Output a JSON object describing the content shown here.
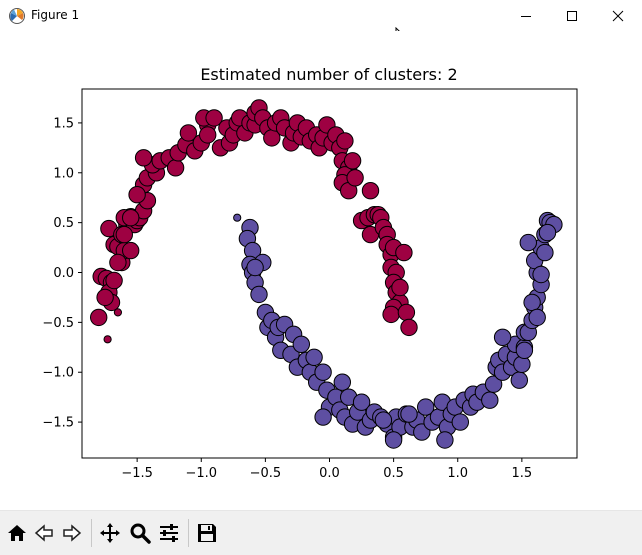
{
  "window": {
    "title": "Figure 1",
    "controls": [
      "minimize",
      "maximize",
      "close"
    ]
  },
  "toolbar": {
    "tools": [
      "home-icon",
      "back-icon",
      "forward-icon",
      "pan-icon",
      "zoom-icon",
      "configure-subplots-icon",
      "save-icon"
    ]
  },
  "colors": {
    "cluster_0": "#9e0142",
    "cluster_1": "#5e4fa2",
    "edge": "#000000"
  },
  "chart_data": {
    "type": "scatter",
    "title": "Estimated number of clusters: 2",
    "xlabel": "",
    "ylabel": "",
    "xlim": [
      -1.93,
      1.93
    ],
    "ylim": [
      -1.86,
      1.84
    ],
    "xticks": [
      -1.5,
      -1.0,
      -0.5,
      0.0,
      0.5,
      1.0,
      1.5
    ],
    "xtick_labels": [
      "−1.5",
      "−1.0",
      "−0.5",
      "0.0",
      "0.5",
      "1.0",
      "1.5"
    ],
    "yticks": [
      -1.5,
      -1.0,
      -0.5,
      0.0,
      0.5,
      1.0,
      1.5
    ],
    "ytick_labels": [
      "−1.5",
      "−1.0",
      "−0.5",
      "0.0",
      "0.5",
      "1.0",
      "1.5"
    ],
    "grid": false,
    "series": [
      {
        "cluster": 0,
        "color": "#9e0142",
        "core_points": [
          [
            -1.78,
            -0.04
          ],
          [
            -1.8,
            -0.45
          ],
          [
            -1.74,
            -0.06
          ],
          [
            -1.7,
            -0.1
          ],
          [
            -1.72,
            -0.2
          ],
          [
            -1.7,
            -0.3
          ],
          [
            -1.68,
            -0.08
          ],
          [
            -1.72,
            0.44
          ],
          [
            -1.68,
            0.28
          ],
          [
            -1.65,
            0.26
          ],
          [
            -1.62,
            0.1
          ],
          [
            -1.6,
            0.22
          ],
          [
            -1.58,
            0.48
          ],
          [
            -1.55,
            0.56
          ],
          [
            -1.6,
            0.55
          ],
          [
            -1.52,
            0.48
          ],
          [
            -1.5,
            0.52
          ],
          [
            -1.48,
            0.55
          ],
          [
            -1.45,
            0.62
          ],
          [
            -1.42,
            0.72
          ],
          [
            -1.45,
            0.88
          ],
          [
            -1.5,
            0.78
          ],
          [
            -1.42,
            0.95
          ],
          [
            -1.35,
            1.0
          ],
          [
            -1.38,
            1.08
          ],
          [
            -1.45,
            1.15
          ],
          [
            -1.32,
            1.12
          ],
          [
            -1.25,
            1.15
          ],
          [
            -1.2,
            1.05
          ],
          [
            -1.18,
            1.2
          ],
          [
            -1.12,
            1.28
          ],
          [
            -1.1,
            1.4
          ],
          [
            -1.05,
            1.22
          ],
          [
            -1.0,
            1.3
          ],
          [
            -0.95,
            1.48
          ],
          [
            -0.98,
            1.55
          ],
          [
            -0.95,
            1.38
          ],
          [
            -0.9,
            1.55
          ],
          [
            -0.85,
            1.25
          ],
          [
            -0.8,
            1.45
          ],
          [
            -0.78,
            1.3
          ],
          [
            -0.75,
            1.38
          ],
          [
            -0.72,
            1.5
          ],
          [
            -0.7,
            1.55
          ],
          [
            -0.66,
            1.4
          ],
          [
            -0.62,
            1.5
          ],
          [
            -0.58,
            1.48
          ],
          [
            -0.58,
            1.6
          ],
          [
            -0.55,
            1.65
          ],
          [
            -0.52,
            1.55
          ],
          [
            -0.48,
            1.45
          ],
          [
            -0.45,
            1.35
          ],
          [
            -0.42,
            1.5
          ],
          [
            -0.38,
            1.55
          ],
          [
            -0.35,
            1.45
          ],
          [
            -0.3,
            1.3
          ],
          [
            -0.28,
            1.4
          ],
          [
            -0.25,
            1.5
          ],
          [
            -0.22,
            1.36
          ],
          [
            -0.18,
            1.45
          ],
          [
            -0.15,
            1.32
          ],
          [
            -0.1,
            1.38
          ],
          [
            -0.08,
            1.25
          ],
          [
            -0.05,
            1.35
          ],
          [
            -0.02,
            1.48
          ],
          [
            0.02,
            1.3
          ],
          [
            0.05,
            1.38
          ],
          [
            0.08,
            1.25
          ],
          [
            0.1,
            1.12
          ],
          [
            0.12,
            1.32
          ],
          [
            0.15,
            1.05
          ],
          [
            0.12,
            0.98
          ],
          [
            0.1,
            0.9
          ],
          [
            0.15,
            0.82
          ],
          [
            0.18,
            1.12
          ],
          [
            0.2,
            0.95
          ],
          [
            0.25,
            0.52
          ],
          [
            0.3,
            0.55
          ],
          [
            0.32,
            0.38
          ],
          [
            0.32,
            0.82
          ],
          [
            0.35,
            0.58
          ],
          [
            0.38,
            0.58
          ],
          [
            0.4,
            0.55
          ],
          [
            0.42,
            0.45
          ],
          [
            0.45,
            0.38
          ],
          [
            0.45,
            0.28
          ],
          [
            0.48,
            0.18
          ],
          [
            0.5,
            0.25
          ],
          [
            0.48,
            0.05
          ],
          [
            0.52,
            0.0
          ],
          [
            0.5,
            -0.1
          ],
          [
            0.52,
            -0.2
          ],
          [
            0.55,
            -0.3
          ],
          [
            0.5,
            -0.35
          ],
          [
            0.48,
            -0.42
          ],
          [
            0.55,
            -0.15
          ],
          [
            0.58,
            0.2
          ],
          [
            0.6,
            -0.4
          ],
          [
            0.62,
            -0.55
          ],
          [
            -1.62,
            0.38
          ],
          [
            -1.55,
            0.55
          ],
          [
            -1.65,
            0.1
          ],
          [
            -1.75,
            -0.25
          ],
          [
            -1.6,
            0.38
          ],
          [
            -1.55,
            0.22
          ]
        ],
        "outliers": [
          [
            -1.73,
            -0.67
          ],
          [
            -1.65,
            -0.4
          ]
        ]
      },
      {
        "cluster": 1,
        "color": "#5e4fa2",
        "core_points": [
          [
            -0.62,
            0.45
          ],
          [
            -0.64,
            0.34
          ],
          [
            -0.6,
            0.22
          ],
          [
            -0.62,
            0.08
          ],
          [
            -0.6,
            0.0
          ],
          [
            -0.58,
            -0.1
          ],
          [
            -0.55,
            -0.22
          ],
          [
            -0.52,
            0.1
          ],
          [
            -0.5,
            -0.4
          ],
          [
            -0.48,
            -0.55
          ],
          [
            -0.45,
            -0.48
          ],
          [
            -0.42,
            -0.65
          ],
          [
            -0.4,
            -0.55
          ],
          [
            -0.35,
            -0.52
          ],
          [
            -0.38,
            -0.78
          ],
          [
            -0.3,
            -0.82
          ],
          [
            -0.28,
            -0.62
          ],
          [
            -0.25,
            -0.95
          ],
          [
            -0.22,
            -0.72
          ],
          [
            -0.18,
            -0.88
          ],
          [
            -0.15,
            -1.0
          ],
          [
            -0.12,
            -0.85
          ],
          [
            -0.1,
            -1.1
          ],
          [
            -0.05,
            -1.0
          ],
          [
            -0.02,
            -1.18
          ],
          [
            0.0,
            -1.35
          ],
          [
            -0.05,
            -1.45
          ],
          [
            0.05,
            -1.25
          ],
          [
            0.08,
            -1.38
          ],
          [
            0.1,
            -1.1
          ],
          [
            0.12,
            -1.45
          ],
          [
            0.15,
            -1.25
          ],
          [
            0.18,
            -1.52
          ],
          [
            0.22,
            -1.4
          ],
          [
            0.25,
            -1.3
          ],
          [
            0.28,
            -1.55
          ],
          [
            0.32,
            -1.48
          ],
          [
            0.35,
            -1.4
          ],
          [
            0.4,
            -1.45
          ],
          [
            0.45,
            -1.52
          ],
          [
            0.5,
            -1.65
          ],
          [
            0.52,
            -1.45
          ],
          [
            0.55,
            -1.55
          ],
          [
            0.6,
            -1.42
          ],
          [
            0.65,
            -1.55
          ],
          [
            0.68,
            -1.48
          ],
          [
            0.72,
            -1.6
          ],
          [
            0.75,
            -1.35
          ],
          [
            0.8,
            -1.5
          ],
          [
            0.85,
            -1.45
          ],
          [
            0.88,
            -1.3
          ],
          [
            0.92,
            -1.55
          ],
          [
            0.95,
            -1.42
          ],
          [
            0.98,
            -1.35
          ],
          [
            1.02,
            -1.5
          ],
          [
            1.05,
            -1.28
          ],
          [
            1.1,
            -1.35
          ],
          [
            1.12,
            -1.22
          ],
          [
            1.15,
            -1.3
          ],
          [
            1.2,
            -1.2
          ],
          [
            1.25,
            -1.28
          ],
          [
            1.28,
            -1.12
          ],
          [
            1.3,
            -0.95
          ],
          [
            1.32,
            -0.88
          ],
          [
            1.35,
            -1.0
          ],
          [
            1.38,
            -0.82
          ],
          [
            1.42,
            -0.95
          ],
          [
            1.45,
            -0.85
          ],
          [
            1.45,
            -0.72
          ],
          [
            1.48,
            -1.08
          ],
          [
            1.5,
            -0.92
          ],
          [
            1.52,
            -0.75
          ],
          [
            1.52,
            -0.6
          ],
          [
            1.55,
            -0.6
          ],
          [
            1.58,
            -0.48
          ],
          [
            1.6,
            -0.35
          ],
          [
            1.62,
            -0.25
          ],
          [
            1.65,
            -0.12
          ],
          [
            1.62,
            0.0
          ],
          [
            1.6,
            0.12
          ],
          [
            1.65,
            0.25
          ],
          [
            1.68,
            0.38
          ],
          [
            1.7,
            0.52
          ],
          [
            1.72,
            0.5
          ],
          [
            1.75,
            0.48
          ],
          [
            1.55,
            0.3
          ],
          [
            1.65,
            -0.02
          ],
          [
            1.68,
            0.2
          ],
          [
            1.7,
            0.4
          ],
          [
            1.52,
            -0.78
          ],
          [
            0.42,
            -1.48
          ],
          [
            0.9,
            -1.68
          ],
          [
            0.5,
            -1.68
          ],
          [
            1.35,
            -0.65
          ],
          [
            -0.58,
            0.05
          ],
          [
            0.62,
            -1.42
          ],
          [
            1.58,
            -0.3
          ],
          [
            1.62,
            -0.45
          ]
        ],
        "outliers": [
          [
            -0.72,
            0.55
          ]
        ]
      }
    ]
  }
}
